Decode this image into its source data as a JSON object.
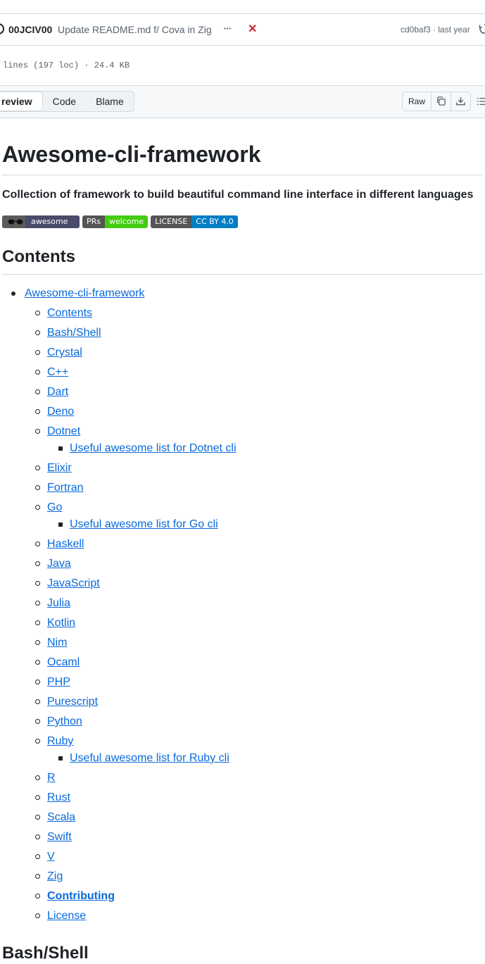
{
  "commit": {
    "author": "00JCIV00",
    "message": "Update README.md f/ Cova in Zig",
    "status_icon": "x-icon",
    "hash_age": "cd0baf3 · last year"
  },
  "file_info": "lines (197 loc) · 24.4 KB",
  "toolbar": {
    "tabs": [
      "review",
      "Code",
      "Blame"
    ],
    "raw_label": "Raw"
  },
  "readme": {
    "title": "Awesome-cli-framework",
    "tagline": "Collection of framework to build beautiful command line interface in different languages",
    "badges": {
      "awesome": "awesome",
      "prs_left": "PRs",
      "prs_right": "welcome",
      "license_left": "LICENSE",
      "license_right": "CC BY 4.0"
    },
    "contents_heading": "Contents",
    "toc_root": "Awesome-cli-framework",
    "toc": [
      {
        "label": "Contents"
      },
      {
        "label": "Bash/Shell"
      },
      {
        "label": "Crystal"
      },
      {
        "label": "C++"
      },
      {
        "label": "Dart"
      },
      {
        "label": "Deno"
      },
      {
        "label": "Dotnet",
        "sub": "Useful awesome list for Dotnet cli"
      },
      {
        "label": "Elixir"
      },
      {
        "label": "Fortran"
      },
      {
        "label": "Go",
        "sub": "Useful awesome list for Go cli"
      },
      {
        "label": "Haskell"
      },
      {
        "label": "Java"
      },
      {
        "label": "JavaScript"
      },
      {
        "label": "Julia"
      },
      {
        "label": "Kotlin"
      },
      {
        "label": "Nim"
      },
      {
        "label": "Ocaml"
      },
      {
        "label": "PHP"
      },
      {
        "label": "Purescript"
      },
      {
        "label": "Python"
      },
      {
        "label": "Ruby",
        "sub": "Useful awesome list for Ruby cli"
      },
      {
        "label": "R"
      },
      {
        "label": "Rust"
      },
      {
        "label": "Scala"
      },
      {
        "label": "Swift"
      },
      {
        "label": "V"
      },
      {
        "label": "Zig"
      },
      {
        "label": "Contributing",
        "bold": true
      },
      {
        "label": "License"
      }
    ],
    "next_heading": "Bash/Shell"
  },
  "colors": {
    "link": "#0969da",
    "text": "#1f2328",
    "muted": "#59636e",
    "border": "#d1d9e0",
    "danger": "#d1242f",
    "prs_green": "#4c1",
    "license_blue": "#007ec6"
  }
}
